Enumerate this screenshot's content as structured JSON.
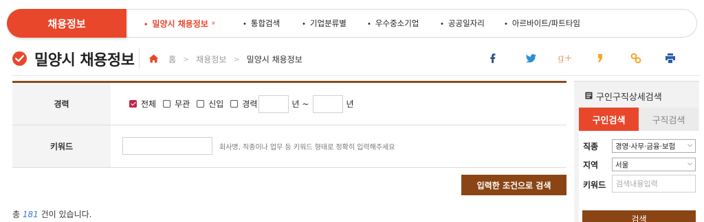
{
  "topbar": {
    "title": "채용정보",
    "active_item": "밀양시 채용정보",
    "items": [
      "통합검색",
      "기업분류별",
      "우수중소기업",
      "공공일자리",
      "아르바이트/파트타임"
    ],
    "chevron": "»"
  },
  "header": {
    "page_title": "밀양시 채용정보",
    "breadcrumb": [
      "홈",
      "채용정보",
      "밀양시 채용정보"
    ],
    "share_icons": [
      "facebook-icon",
      "twitter-icon",
      "google-plus-icon",
      "kakao-icon",
      "link-icon",
      "print-icon"
    ]
  },
  "colors": {
    "accent": "#e8472b",
    "brown": "#8b4515",
    "count_blue": "#3a7bd5"
  },
  "form": {
    "career_label": "경력",
    "career_options": [
      {
        "label": "전체",
        "checked": true
      },
      {
        "label": "무관",
        "checked": false
      },
      {
        "label": "신입",
        "checked": false
      },
      {
        "label": "경력",
        "checked": false
      }
    ],
    "year_unit": "년",
    "range_sep": "~",
    "keyword_label": "키워드",
    "keyword_hint": "회사명, 직종이나 업무 등 키워드 형태로 정확히 입력해주세요",
    "search_button": "입력한 조건으로 검색"
  },
  "result": {
    "prefix": "총",
    "count": "181",
    "suffix": "건이 있습니다."
  },
  "sidebar": {
    "title": "구인구직상세검색",
    "tabs": [
      "구인검색",
      "구직검색"
    ],
    "job_label": "직종",
    "job_value": "경영·사무·금융·보험",
    "region_label": "지역",
    "region_value": "서울",
    "keyword_label": "키워드",
    "keyword_placeholder": "검색내용입력",
    "search_button": "검색"
  }
}
